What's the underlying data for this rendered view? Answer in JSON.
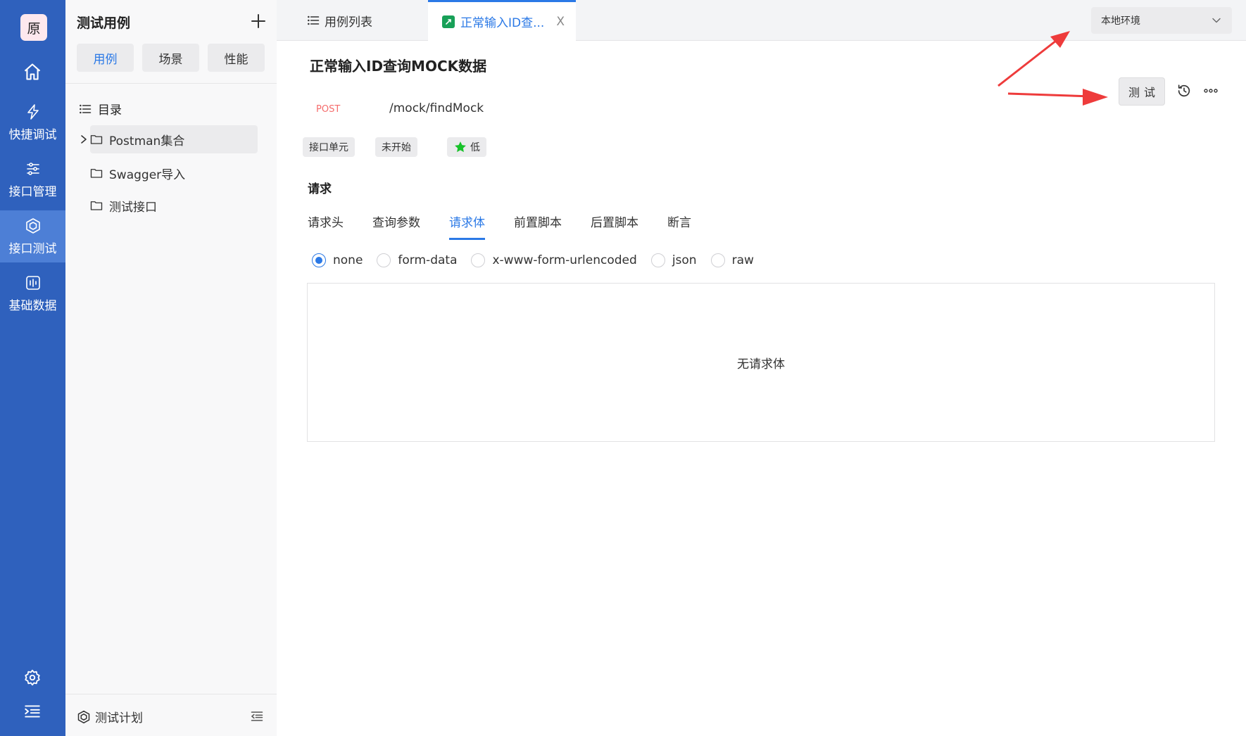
{
  "rail": {
    "logo": "原",
    "items": [
      {
        "label": "快捷调试",
        "icon": "lightning-icon"
      },
      {
        "label": "接口管理",
        "icon": "sliders-icon"
      },
      {
        "label": "接口测试",
        "icon": "cube-icon"
      },
      {
        "label": "基础数据",
        "icon": "chart-box-icon"
      }
    ],
    "active_index": 2
  },
  "sidebar": {
    "title": "测试用例",
    "tabs": [
      "用例",
      "场景",
      "性能"
    ],
    "active_tab": 0,
    "directory_label": "目录",
    "tree": [
      "Postman集合",
      "Swagger导入",
      "测试接口"
    ],
    "footer_label": "测试计划"
  },
  "tabs": [
    {
      "label": "用例列表",
      "icon": "list-icon"
    },
    {
      "label": "正常输入ID查...",
      "icon": "edit-icon",
      "close": "X"
    }
  ],
  "env": {
    "selected": "本地环境"
  },
  "case": {
    "title": "正常输入ID查询MOCK数据",
    "method": "POST",
    "path": "/mock/findMock",
    "tags": [
      "接口单元",
      "未开始",
      "低"
    ],
    "priority_color": "#18c22a",
    "test_button": "测试"
  },
  "request": {
    "section_label": "请求",
    "tabs": [
      "请求头",
      "查询参数",
      "请求体",
      "前置脚本",
      "后置脚本",
      "断言"
    ],
    "active_tab": 2,
    "body_types": [
      "none",
      "form-data",
      "x-www-form-urlencoded",
      "json",
      "raw"
    ],
    "selected_body_type": 0,
    "empty_text": "无请求体"
  },
  "colors": {
    "rail": "#2f61bd",
    "accent": "#2b79e6",
    "method_post": "#f56c6c",
    "annotation": "#ee3b3b"
  }
}
